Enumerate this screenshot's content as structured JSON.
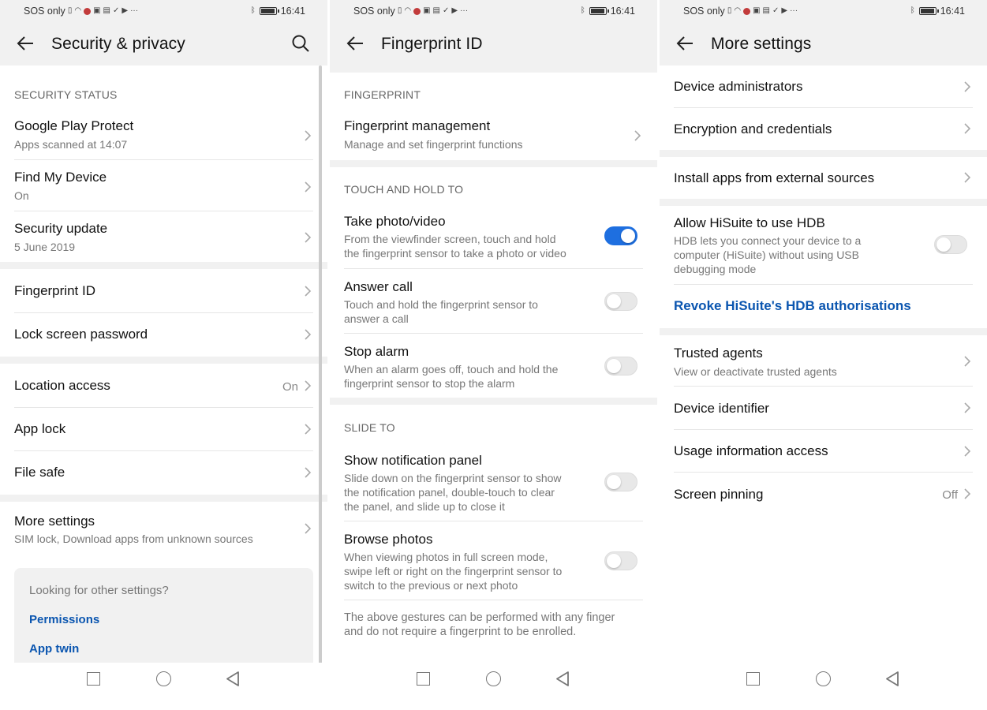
{
  "status_bar": {
    "left_text": "SOS only",
    "time": "16:41"
  },
  "colors": {
    "accent": "#1e6fe0",
    "link": "#0b56b0",
    "toolbar_bg": "#f1f1f1",
    "recording_dot": "#c23b3b"
  },
  "icons": {
    "back": "arrow-left-icon",
    "search": "magnifier-icon",
    "chevron": "chevron-right-icon",
    "nav_recents": "square-icon",
    "nav_home": "circle-icon",
    "nav_back": "triangle-left-icon"
  },
  "screen1": {
    "title": "Security & privacy",
    "section_security_status": "SECURITY STATUS",
    "play_protect": {
      "title": "Google Play Protect",
      "subtitle": "Apps scanned at 14:07"
    },
    "find_my_device": {
      "title": "Find My Device",
      "subtitle": "On"
    },
    "security_update": {
      "title": "Security update",
      "subtitle": "5 June 2019"
    },
    "fingerprint_id": {
      "title": "Fingerprint ID"
    },
    "lock_screen_password": {
      "title": "Lock screen password"
    },
    "location_access": {
      "title": "Location access",
      "value": "On"
    },
    "app_lock": {
      "title": "App lock"
    },
    "file_safe": {
      "title": "File safe"
    },
    "more_settings": {
      "title": "More settings",
      "subtitle": "SIM lock, Download apps from unknown sources"
    },
    "card": {
      "title": "Looking for other settings?",
      "link_permissions": "Permissions",
      "link_app_twin": "App twin"
    }
  },
  "screen2": {
    "title": "Fingerprint ID",
    "section_fingerprint": "FINGERPRINT",
    "fingerprint_management": {
      "title": "Fingerprint management",
      "subtitle": "Manage and set fingerprint functions"
    },
    "section_touch_hold": "TOUCH AND HOLD TO",
    "take_photo": {
      "title": "Take photo/video",
      "line1": "From the viewfinder screen, touch and hold",
      "line2": "the fingerprint sensor to take a photo or video",
      "enabled": true
    },
    "answer_call": {
      "title": "Answer call",
      "line1": "Touch and hold the fingerprint sensor to",
      "line2": "answer a call",
      "enabled": false
    },
    "stop_alarm": {
      "title": "Stop alarm",
      "line1": "When an alarm goes off, touch and hold the",
      "line2": "fingerprint sensor to stop the alarm",
      "enabled": false
    },
    "section_slide": "SLIDE TO",
    "show_notification": {
      "title": "Show notification panel",
      "line1": "Slide down on the fingerprint sensor to show",
      "line2": "the notification panel, double-touch to clear",
      "line3": "the panel, and slide up to close it",
      "enabled": false
    },
    "browse_photos": {
      "title": "Browse photos",
      "line1": "When viewing photos in full screen mode,",
      "line2": "swipe left or right on the fingerprint sensor to",
      "line3": "switch to the previous or next photo",
      "enabled": false
    },
    "footnote_line1": "The above gestures can be performed with any finger",
    "footnote_line2": "and do not require a fingerprint to be enrolled."
  },
  "screen3": {
    "title": "More settings",
    "device_admins": {
      "title": "Device administrators"
    },
    "encryption": {
      "title": "Encryption and credentials"
    },
    "install_apps": {
      "title": "Install apps from external sources"
    },
    "hisuite_hdb": {
      "title": "Allow HiSuite to use HDB",
      "line1": "HDB lets you connect your device to a",
      "line2": "computer (HiSuite) without using USB",
      "line3": "debugging mode",
      "enabled": false
    },
    "revoke_link": "Revoke HiSuite's HDB authorisations",
    "trusted_agents": {
      "title": "Trusted agents",
      "subtitle": "View or deactivate trusted agents"
    },
    "device_identifier": {
      "title": "Device identifier"
    },
    "usage_access": {
      "title": "Usage information access"
    },
    "screen_pinning": {
      "title": "Screen pinning",
      "value": "Off"
    }
  }
}
